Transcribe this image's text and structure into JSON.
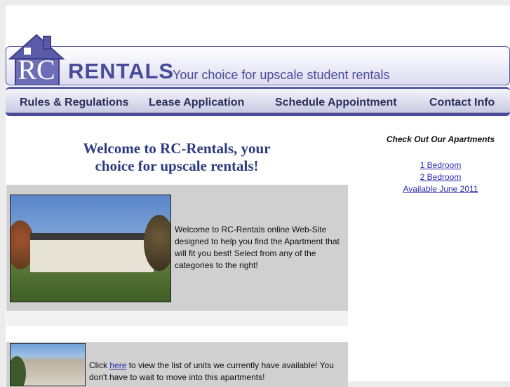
{
  "logo": {
    "rc": "RC",
    "rentals": "RENTALS",
    "tagline": "Your choice for upscale student rentals"
  },
  "nav": {
    "items": [
      {
        "label": "Rules & Regulations"
      },
      {
        "label": "Lease Application"
      },
      {
        "label": "Schedule Appointment"
      },
      {
        "label": "Contact Info"
      }
    ]
  },
  "welcome": {
    "line1": "Welcome to RC-Rentals, your",
    "line2": "choice for upscale rentals!"
  },
  "sidebar": {
    "title": "Check Out Our Apartments",
    "links": [
      {
        "label": "1 Bedroom"
      },
      {
        "label": "2 Bedroom"
      },
      {
        "label": "Available June 2011"
      }
    ]
  },
  "panel1": {
    "text": "Welcome to RC-Rentals online Web-Site designed to help you find the Apartment that will fit you best! Select from any of the categories to the right!"
  },
  "panel2": {
    "text_before": "Click ",
    "link": "here",
    "text_after": " to view the list of units we currently have available! You don't have to wait to move into this apartments!"
  },
  "colors": {
    "brand": "#4a4a9a",
    "link": "#2a2ab0",
    "heading": "#2e3a80"
  }
}
